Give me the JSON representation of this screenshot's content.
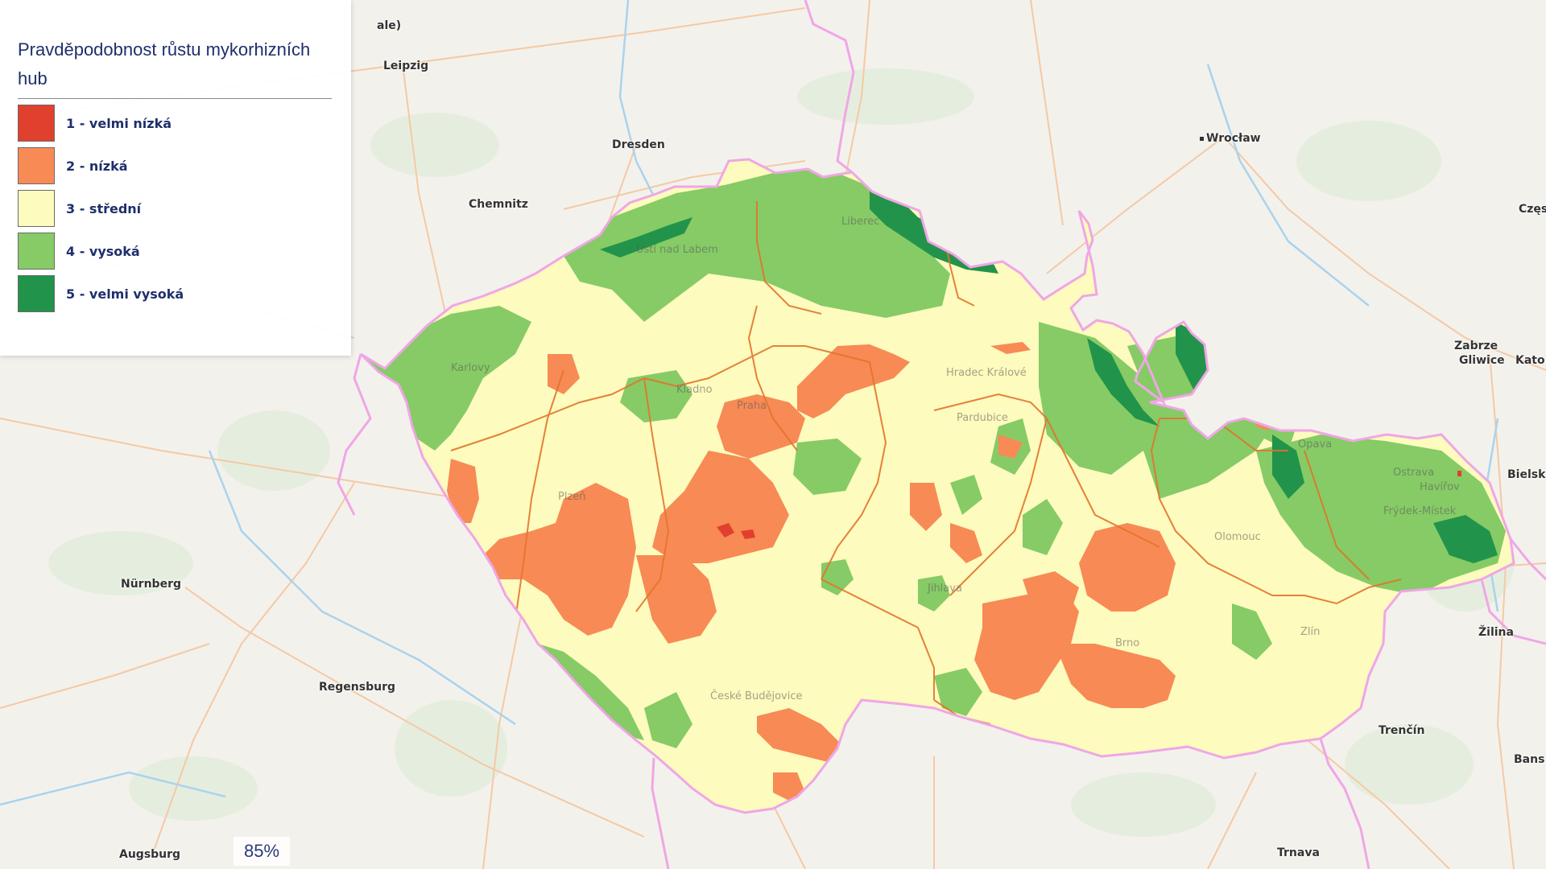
{
  "legend": {
    "title": "Pravděpodobnost růstu mykorhizních hub",
    "items": [
      {
        "label": "1 - velmi nízká",
        "color": "#e0402d"
      },
      {
        "label": "2 - nízká",
        "color": "#f88a55"
      },
      {
        "label": "3 - střední",
        "color": "#fdfbbd"
      },
      {
        "label": "4 - vysoká",
        "color": "#86cb66"
      },
      {
        "label": "5 - velmi vysoká",
        "color": "#22934a"
      }
    ]
  },
  "zoom": {
    "level": "85%"
  },
  "cities": {
    "leipzig": "Leipzig",
    "dresden": "Dresden",
    "chemnitz": "Chemnitz",
    "wroclaw": "Wrocław",
    "nurnberg": "Nürnberg",
    "regensburg": "Regensburg",
    "augsburg": "Augsburg",
    "zabrze": "Zabrze",
    "gliwice": "Gliwice",
    "katowice": "Kato",
    "bielsko": "Bielsk",
    "zilina": "Žilina",
    "trencin": "Trenčín",
    "trnava": "Trnava",
    "banska": "Bans",
    "czestochowa": "Częs",
    "halle": "ale)"
  },
  "cz_labels": {
    "usti": "Ústí nad Labem",
    "liberec": "Liberec",
    "karlovy": "Karlovy",
    "kladno": "Kladno",
    "praha": "Praha",
    "hradec": "Hradec Králové",
    "pardubice": "Pardubice",
    "plzen": "Plzeň",
    "jihlava": "Jihlava",
    "brno": "Brno",
    "olomouc": "Olomouc",
    "ostrava": "Ostrava",
    "havirov": "Havířov",
    "frydek": "Frýdek-Místek",
    "opava": "Opava",
    "zlin": "Zlín",
    "budejovice": "České Budějovice"
  },
  "colors": {
    "background": "#f3f1ec",
    "roads": "#f4c9a4",
    "rivers": "#a9d3ee",
    "border_country": "#f0a6e6",
    "border_region": "#e2742c"
  }
}
